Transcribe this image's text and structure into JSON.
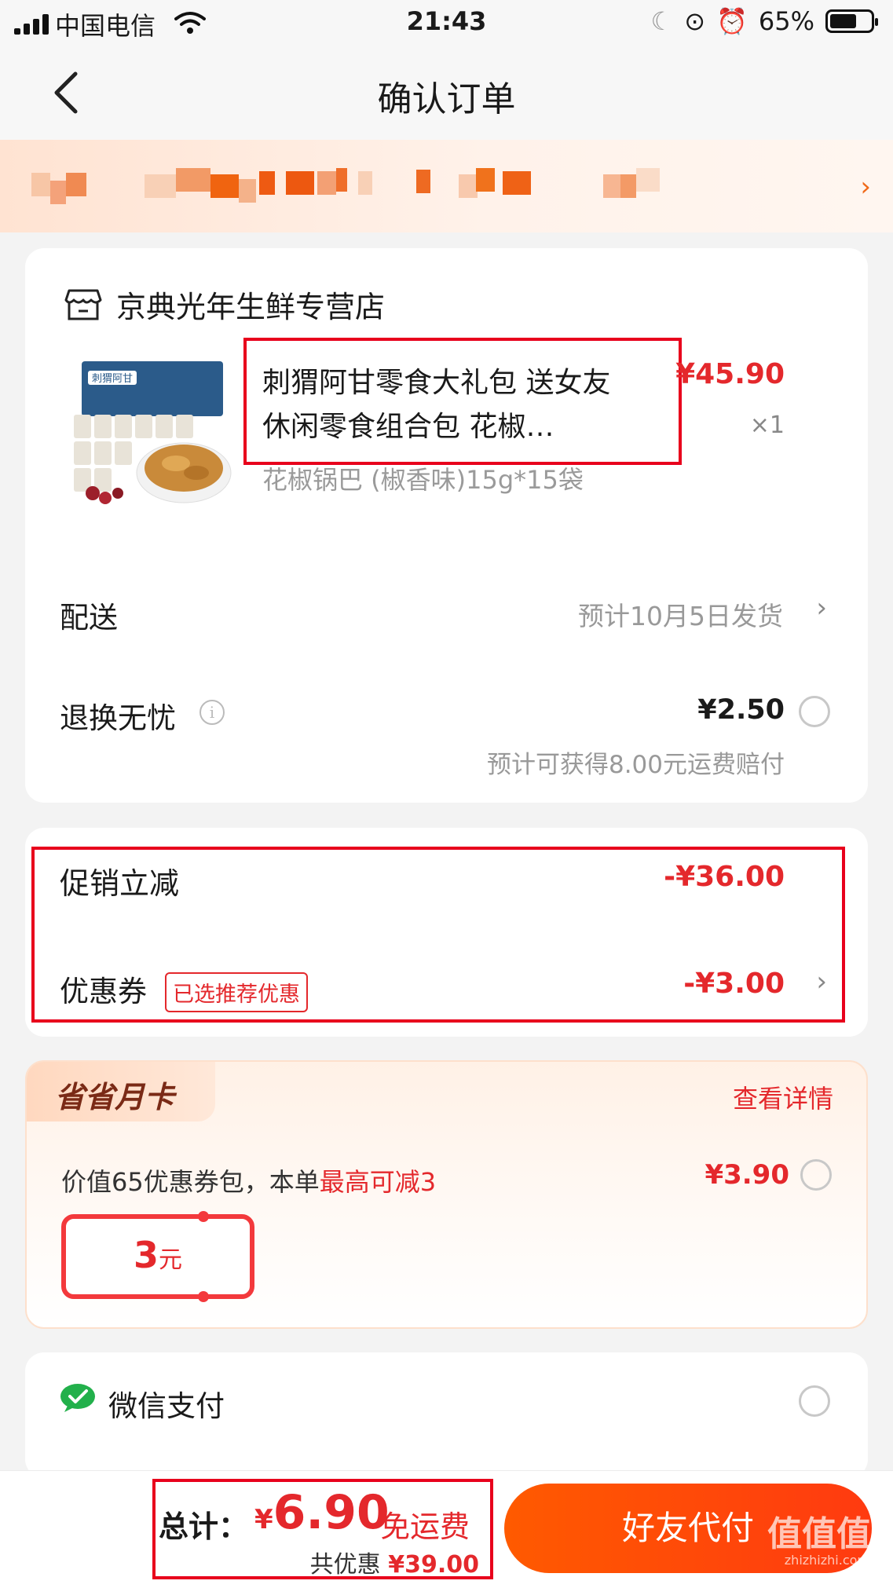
{
  "status_bar": {
    "carrier": "中国电信",
    "time": "21:43",
    "battery": "65%"
  },
  "nav": {
    "title": "确认订单"
  },
  "shop": {
    "name": "京典光年生鲜专营店"
  },
  "product": {
    "name": "刺猬阿甘零食大礼包 送女友休闲零食组合包 花椒…",
    "price": "¥45.90",
    "qty": "×1",
    "spec": "花椒锅巴 (椒香味)15g*15袋",
    "image_text": "刺猬阿甘"
  },
  "delivery": {
    "label": "配送",
    "value": "预计10月5日发货"
  },
  "return_service": {
    "label": "退换无忧",
    "price": "¥2.50",
    "note": "预计可获得8.00元运费赔付"
  },
  "discounts": {
    "promo_label": "促销立减",
    "promo_value": "-¥36.00",
    "coupon_label": "优惠券",
    "coupon_tag": "已选推荐优惠",
    "coupon_value": "-¥3.00"
  },
  "month_card": {
    "title": "省省月卡",
    "detail_link": "查看详情",
    "desc": "价值65优惠券包，本单",
    "desc_highlight": "最高可减3",
    "price": "¥3.90",
    "coupon_value": "3",
    "coupon_unit": "元"
  },
  "payment": {
    "label": "微信支付"
  },
  "bottom": {
    "total_label": "总计：",
    "currency": "¥",
    "total": "6.90",
    "free_shipping": "免运费",
    "saved_label": "共优惠",
    "saved_value": "¥39.00",
    "pay_button": "好友代付",
    "watermark": "值值值",
    "watermark_sub": "zhizhizhi.com"
  },
  "colors": {
    "accent": "#e4282c",
    "button": "#ff5a00",
    "highlight_box": "#e8001c"
  }
}
